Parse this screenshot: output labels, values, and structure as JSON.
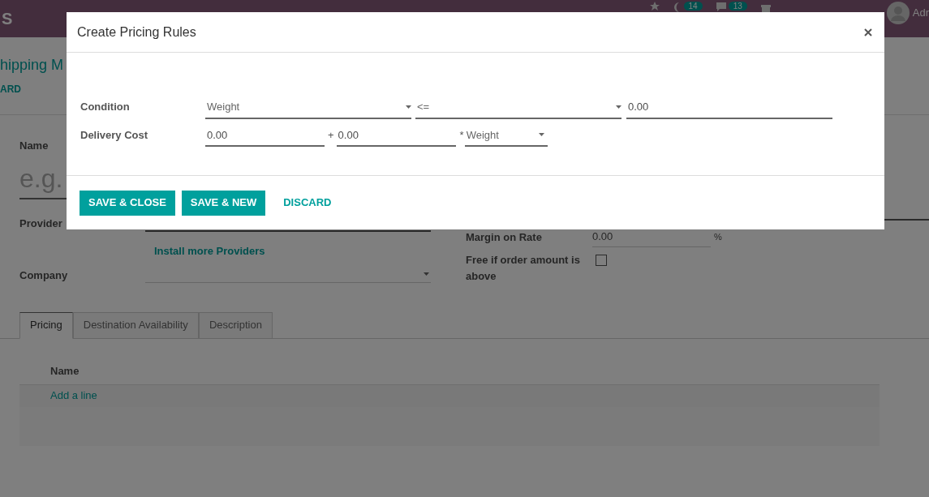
{
  "navbar": {
    "brand": "S",
    "badges": [
      {
        "count": "14"
      },
      {
        "count": "13"
      }
    ],
    "user": "Adr"
  },
  "breadcrumb": "hipping M",
  "action": "ARD",
  "form": {
    "name": {
      "label": "Name",
      "placeholder": "e.g."
    },
    "provider": {
      "label": "Provider"
    },
    "install_link": "Install more Providers",
    "company": {
      "label": "Company"
    },
    "margin": {
      "label": "Margin on Rate",
      "value": "0.00",
      "unit": "%"
    },
    "free_over": {
      "label": "Free if order amount is above",
      "checked": false
    }
  },
  "tabs": [
    {
      "label": "Pricing",
      "selected": true
    },
    {
      "label": "Destination Availability",
      "selected": false
    },
    {
      "label": "Description",
      "selected": false
    }
  ],
  "table": {
    "columns": [
      "Name"
    ],
    "add_line": "Add a line"
  },
  "dialog": {
    "title": "Create Pricing Rules",
    "condition": {
      "label": "Condition",
      "variable": "Weight",
      "operator": "<=",
      "value": "0.00"
    },
    "delivery_cost": {
      "label": "Delivery Cost",
      "fixed": "0.00",
      "plus": "+",
      "factor": "0.00",
      "times": "*",
      "variable": "Weight"
    },
    "buttons": [
      {
        "label": "SAVE & CLOSE",
        "kind": "primary"
      },
      {
        "label": "SAVE & NEW",
        "kind": "primary"
      },
      {
        "label": "DISCARD",
        "kind": "link"
      }
    ]
  }
}
